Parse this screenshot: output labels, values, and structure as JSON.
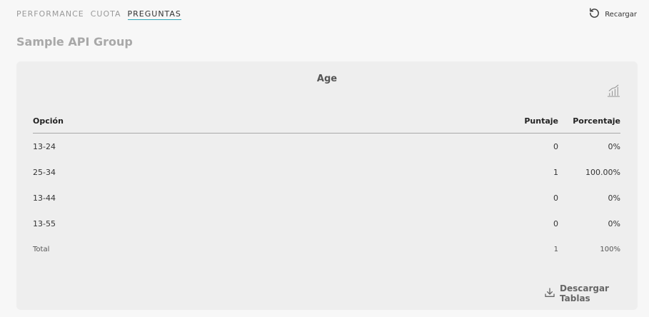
{
  "tabs": [
    {
      "label": "PERFORMANCE",
      "active": false
    },
    {
      "label": "CUOTA",
      "active": false
    },
    {
      "label": "PREGUNTAS",
      "active": true
    }
  ],
  "reload": {
    "label": "Recargar",
    "icon": "reload-icon"
  },
  "page_title": "Sample API Group",
  "card": {
    "question": "Age",
    "chart_icon": "bar-chart-icon",
    "table": {
      "headers": {
        "option": "Opción",
        "score": "Puntaje",
        "percent": "Porcentaje"
      },
      "rows": [
        {
          "option": "13-24",
          "score": "0",
          "percent": "0%"
        },
        {
          "option": "25-34",
          "score": "1",
          "percent": "100.00%"
        },
        {
          "option": "13-44",
          "score": "0",
          "percent": "0%"
        },
        {
          "option": "13-55",
          "score": "0",
          "percent": "0%"
        }
      ],
      "total": {
        "option": "Total",
        "score": "1",
        "percent": "100%"
      }
    },
    "download": {
      "label": "Descargar Tablas",
      "icon": "download-icon"
    }
  },
  "colors": {
    "accent": "#2fa7b8",
    "background": "#f7f7f7",
    "card": "#eeeeee"
  }
}
